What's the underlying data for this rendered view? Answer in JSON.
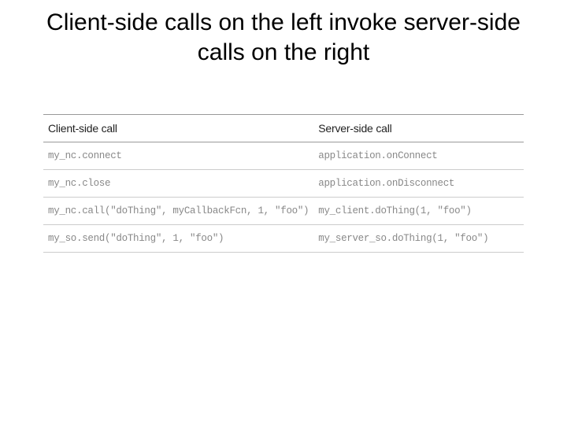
{
  "title": "Client-side calls on the left invoke server-side calls on the right",
  "table": {
    "headers": {
      "left": "Client-side call",
      "right": "Server-side call"
    },
    "rows": [
      {
        "client": "my_nc.connect",
        "server": "application.onConnect"
      },
      {
        "client": "my_nc.close",
        "server": "application.onDisconnect"
      },
      {
        "client": "my_nc.call(\"doThing\", myCallbackFcn, 1, \"foo\")",
        "server": "my_client.doThing(1, \"foo\")"
      },
      {
        "client": "my_so.send(\"doThing\", 1, \"foo\")",
        "server": "my_server_so.doThing(1, \"foo\")"
      }
    ]
  }
}
